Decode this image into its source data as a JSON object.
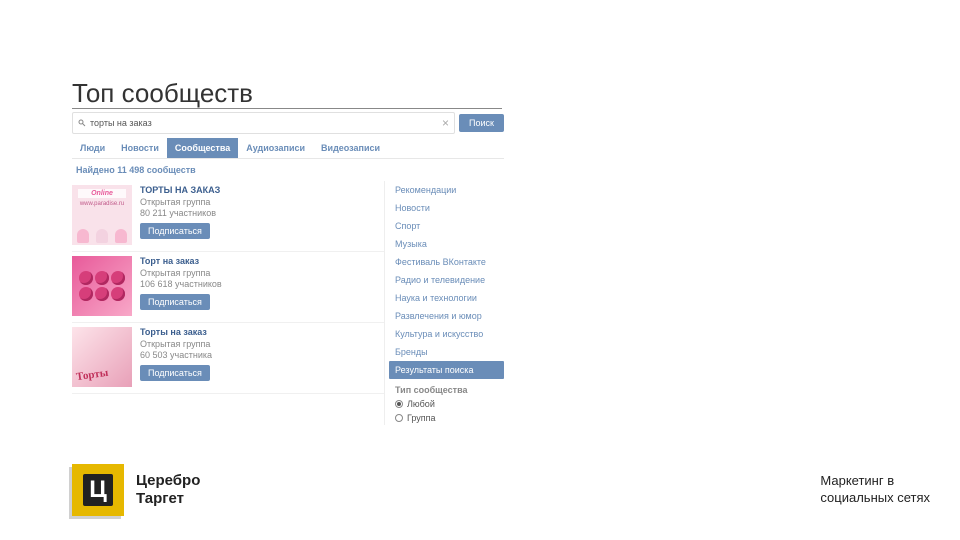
{
  "slide_title": "Топ сообществ",
  "search": {
    "query": "торты на заказ",
    "button": "Поиск"
  },
  "tabs": [
    "Люди",
    "Новости",
    "Сообщества",
    "Аудиозаписи",
    "Видеозаписи"
  ],
  "active_tab_index": 2,
  "found_text": "Найдено 11 498 сообществ",
  "cards": [
    {
      "title": "ТОРТЫ НА ЗАКАЗ",
      "type": "Открытая группа",
      "members": "80 211 участников",
      "thumb_label": "Online",
      "thumb_sub": "www.paradise.ru",
      "button": "Подписаться"
    },
    {
      "title": "Торт на заказ",
      "type": "Открытая группа",
      "members": "106 618 участников",
      "button": "Подписаться"
    },
    {
      "title": "Торты на заказ",
      "type": "Открытая группа",
      "members": "60 503 участника",
      "thumb_label": "Торты",
      "button": "Подписаться"
    }
  ],
  "sidebar": {
    "categories": [
      "Рекомендации",
      "Новости",
      "Спорт",
      "Музыка",
      "Фестиваль ВКонтакте",
      "Радио и телевидение",
      "Наука и технологии",
      "Развлечения и юмор",
      "Культура и искусство",
      "Бренды",
      "Результаты поиска"
    ],
    "active_index": 10,
    "type_header": "Тип сообщества",
    "type_options": [
      "Любой",
      "Группа"
    ],
    "type_selected": 0
  },
  "footer": {
    "brand1": "Церебро",
    "brand2": "Таргет",
    "logo_letter": "Ц",
    "tagline1": "Маркетинг в",
    "tagline2": "социальных сетях"
  }
}
